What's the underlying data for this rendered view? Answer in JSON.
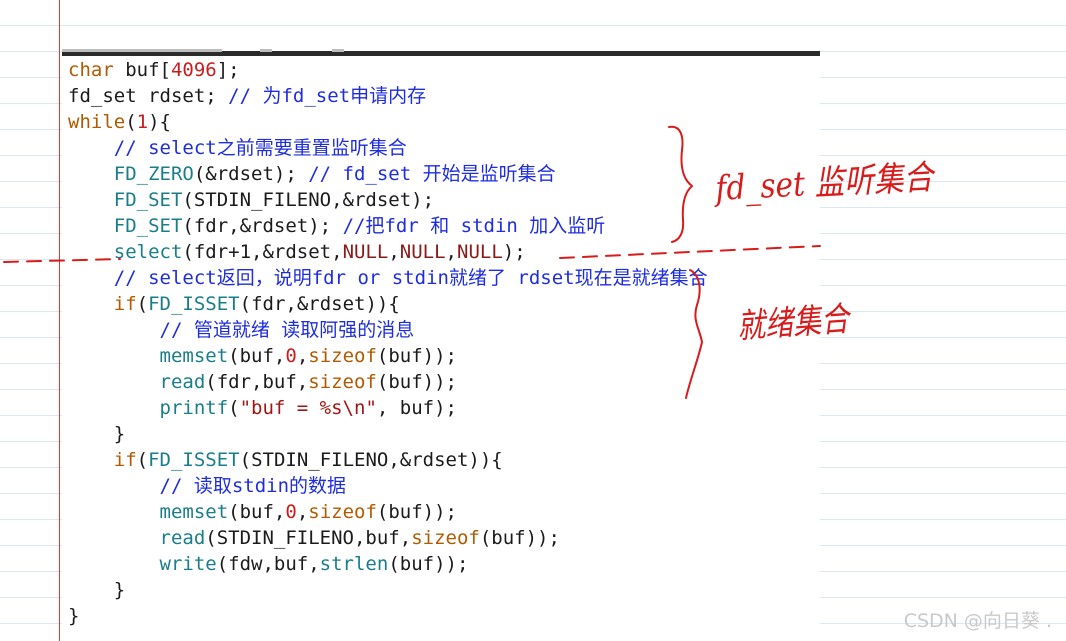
{
  "code_lines": [
    {
      "indent": "",
      "tokens": [
        {
          "t": "char",
          "c": "kw"
        },
        {
          "t": " buf["
        },
        {
          "t": "4096",
          "c": "num"
        },
        {
          "t": "];"
        }
      ]
    },
    {
      "indent": "",
      "tokens": [
        {
          "t": "fd_set rdset; "
        },
        {
          "t": "// 为fd_set申请内存",
          "c": "cm"
        }
      ]
    },
    {
      "indent": "",
      "tokens": [
        {
          "t": "while",
          "c": "kw"
        },
        {
          "t": "("
        },
        {
          "t": "1",
          "c": "num"
        },
        {
          "t": "){"
        }
      ]
    },
    {
      "indent": "    ",
      "tokens": [
        {
          "t": "// select之前需要重置监听集合",
          "c": "cm"
        }
      ]
    },
    {
      "indent": "    ",
      "tokens": [
        {
          "t": "FD_ZERO",
          "c": "macro"
        },
        {
          "t": "(&rdset); "
        },
        {
          "t": "// fd_set 开始是监听集合",
          "c": "cm"
        }
      ]
    },
    {
      "indent": "    ",
      "tokens": [
        {
          "t": "FD_SET",
          "c": "macro"
        },
        {
          "t": "(STDIN_FILENO,&rdset);"
        }
      ]
    },
    {
      "indent": "    ",
      "tokens": [
        {
          "t": "FD_SET",
          "c": "macro"
        },
        {
          "t": "(fdr,&rdset); "
        },
        {
          "t": "//把fdr 和 stdin 加入监听",
          "c": "cm"
        }
      ]
    },
    {
      "indent": "    ",
      "tokens": [
        {
          "t": "select",
          "c": "fn"
        },
        {
          "t": "(fdr+1,&rdset,"
        },
        {
          "t": "NULL",
          "c": "nul"
        },
        {
          "t": ","
        },
        {
          "t": "NULL",
          "c": "nul"
        },
        {
          "t": ","
        },
        {
          "t": "NULL",
          "c": "nul"
        },
        {
          "t": ");"
        }
      ]
    },
    {
      "indent": "    ",
      "tokens": [
        {
          "t": "// select返回，说明fdr or stdin就绪了 rdset现在是就绪集合",
          "c": "cm"
        }
      ]
    },
    {
      "indent": "    ",
      "tokens": [
        {
          "t": "if",
          "c": "kw"
        },
        {
          "t": "("
        },
        {
          "t": "FD_ISSET",
          "c": "macro"
        },
        {
          "t": "(fdr,&rdset)){"
        }
      ]
    },
    {
      "indent": "        ",
      "tokens": [
        {
          "t": "// 管道就绪 读取阿强的消息",
          "c": "cm"
        }
      ]
    },
    {
      "indent": "        ",
      "tokens": [
        {
          "t": "memset",
          "c": "fn"
        },
        {
          "t": "(buf,"
        },
        {
          "t": "0",
          "c": "num"
        },
        {
          "t": ","
        },
        {
          "t": "sizeof",
          "c": "kw"
        },
        {
          "t": "(buf));"
        }
      ]
    },
    {
      "indent": "        ",
      "tokens": [
        {
          "t": "read",
          "c": "fn"
        },
        {
          "t": "(fdr,buf,"
        },
        {
          "t": "sizeof",
          "c": "kw"
        },
        {
          "t": "(buf));"
        }
      ]
    },
    {
      "indent": "        ",
      "tokens": [
        {
          "t": "printf",
          "c": "fn"
        },
        {
          "t": "("
        },
        {
          "t": "\"buf = %s\\n\"",
          "c": "str"
        },
        {
          "t": ", buf);"
        }
      ]
    },
    {
      "indent": "    ",
      "tokens": [
        {
          "t": "}"
        }
      ]
    },
    {
      "indent": "    ",
      "tokens": [
        {
          "t": "if",
          "c": "kw"
        },
        {
          "t": "("
        },
        {
          "t": "FD_ISSET",
          "c": "macro"
        },
        {
          "t": "(STDIN_FILENO,&rdset)){"
        }
      ]
    },
    {
      "indent": "        ",
      "tokens": [
        {
          "t": "// 读取stdin的数据",
          "c": "cm"
        }
      ]
    },
    {
      "indent": "        ",
      "tokens": [
        {
          "t": "memset",
          "c": "fn"
        },
        {
          "t": "(buf,"
        },
        {
          "t": "0",
          "c": "num"
        },
        {
          "t": ","
        },
        {
          "t": "sizeof",
          "c": "kw"
        },
        {
          "t": "(buf));"
        }
      ]
    },
    {
      "indent": "        ",
      "tokens": [
        {
          "t": "read",
          "c": "fn"
        },
        {
          "t": "(STDIN_FILENO,buf,"
        },
        {
          "t": "sizeof",
          "c": "kw"
        },
        {
          "t": "(buf));"
        }
      ]
    },
    {
      "indent": "        ",
      "tokens": [
        {
          "t": "write",
          "c": "fn"
        },
        {
          "t": "(fdw,buf,"
        },
        {
          "t": "strlen",
          "c": "fn"
        },
        {
          "t": "(buf));"
        }
      ]
    },
    {
      "indent": "    ",
      "tokens": [
        {
          "t": "}"
        }
      ]
    },
    {
      "indent": "",
      "tokens": [
        {
          "t": "}"
        }
      ]
    }
  ],
  "annotations": {
    "label_upper": "fd_set 监听集合",
    "label_lower": "就绪集合",
    "ink_color": "#d81b1b"
  },
  "watermark": "CSDN @向日葵 ."
}
